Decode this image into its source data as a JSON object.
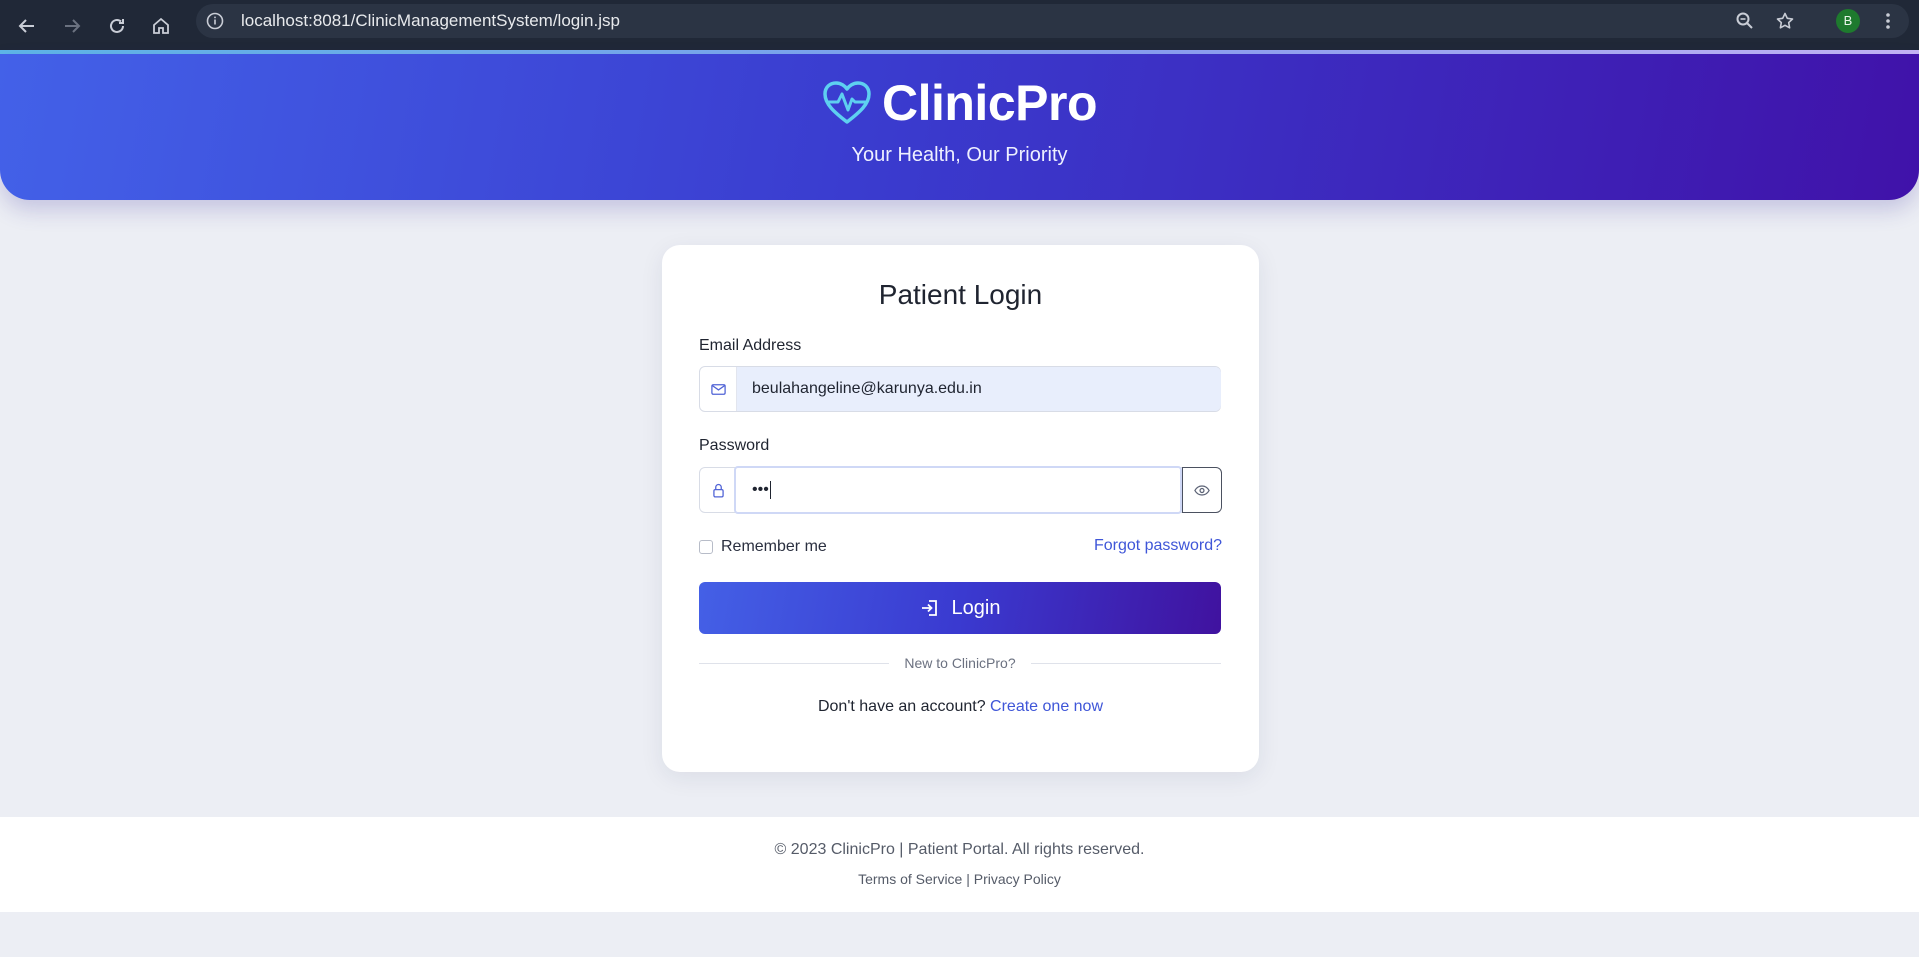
{
  "browser": {
    "url": "localhost:8081/ClinicManagementSystem/login.jsp",
    "profile_initial": "B"
  },
  "header": {
    "brand": "ClinicPro",
    "tagline": "Your Health, Our Priority"
  },
  "login_card": {
    "title": "Patient Login",
    "email_label": "Email Address",
    "email_value": "beulahangeline@karunya.edu.in",
    "password_label": "Password",
    "password_masked": "•••",
    "remember_label": "Remember me",
    "forgot_label": "Forgot password?",
    "login_label": "Login",
    "divider_text": "New to ClinicPro?",
    "signup_prompt": "Don't have an account?",
    "signup_link": "Create one now"
  },
  "footer": {
    "copyright": "© 2023 ClinicPro | Patient Portal. All rights reserved.",
    "terms": "Terms of Service",
    "separator": "|",
    "privacy": "Privacy Policy"
  },
  "colors": {
    "primary": "#4361e8",
    "primary_dark": "#4012a9",
    "link": "#3f56d8",
    "logo_accent": "#5ed0f0"
  }
}
